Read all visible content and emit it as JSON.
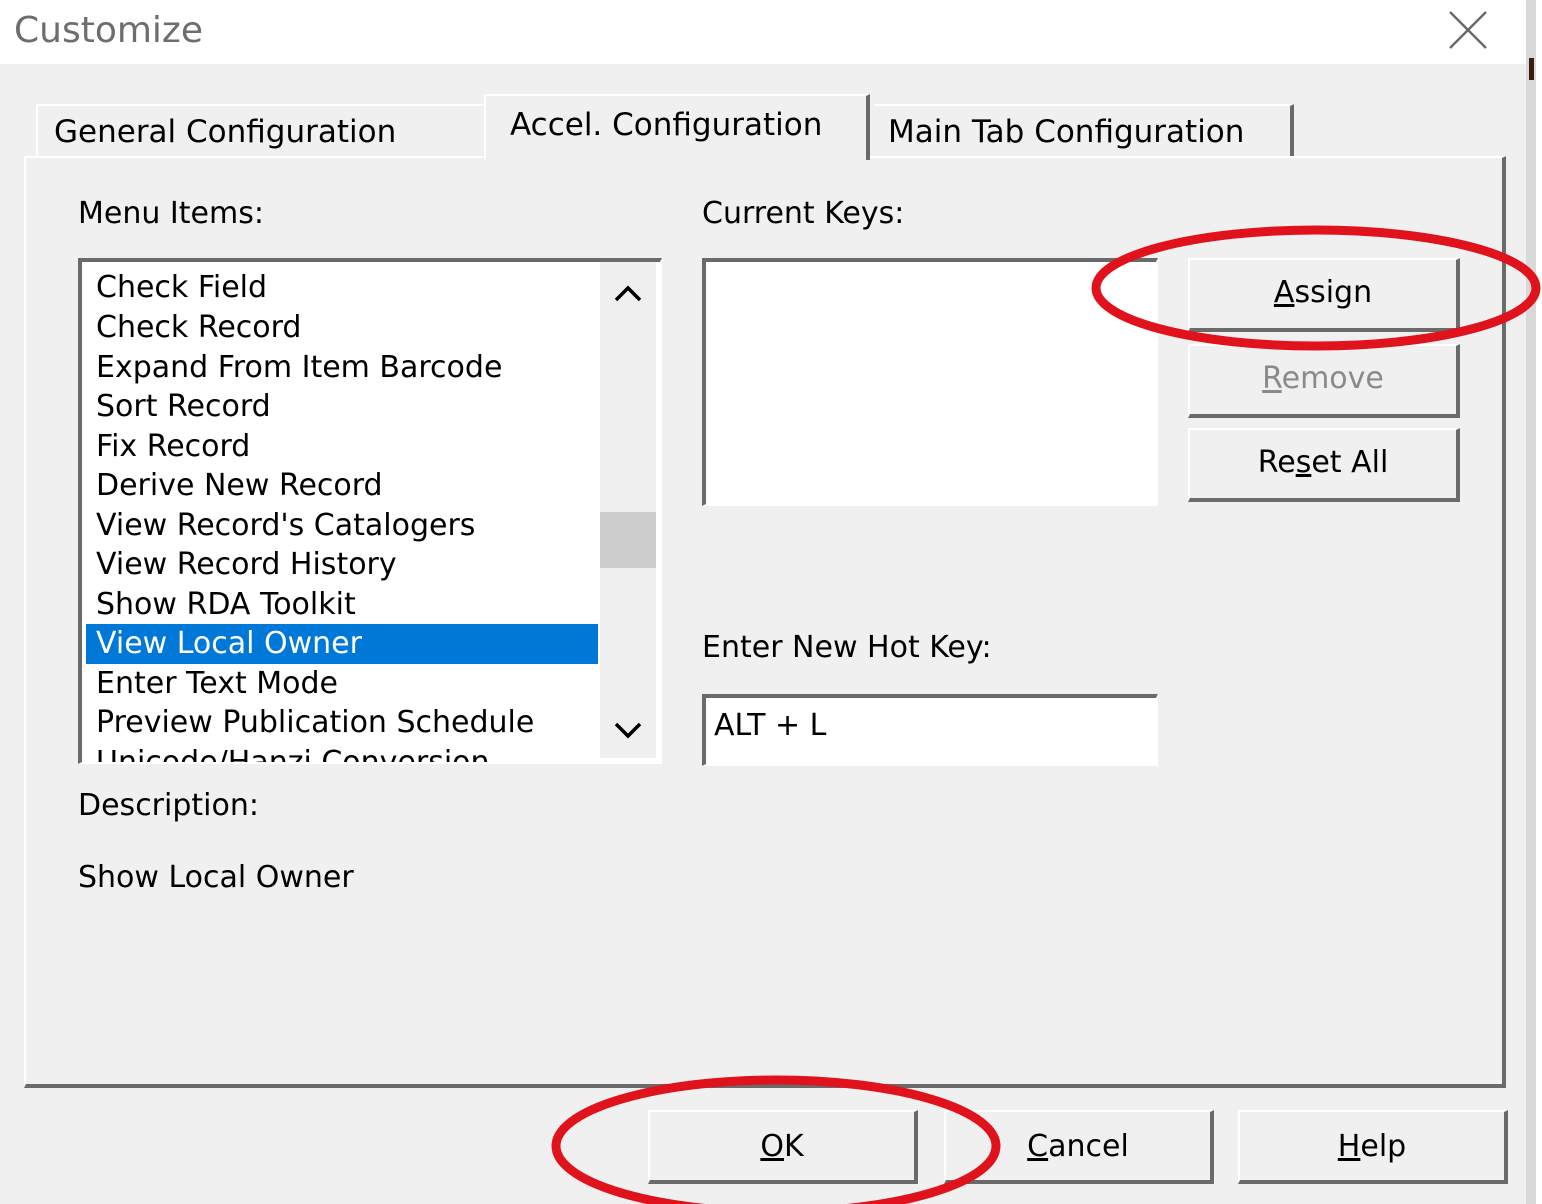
{
  "window": {
    "title": "Customize"
  },
  "tabs": [
    {
      "label": "General Configuration",
      "active": false
    },
    {
      "label": "Accel. Configuration",
      "active": true
    },
    {
      "label": "Main Tab Configuration",
      "active": false
    }
  ],
  "menu_items": {
    "label": "Menu Items:",
    "items": [
      "Check Field",
      "Check Record",
      "Expand From Item Barcode",
      "Sort Record",
      "Fix Record",
      "Derive New Record",
      "View Record's Catalogers",
      "View Record History",
      "Show RDA Toolkit",
      "View Local Owner",
      "Enter Text Mode",
      "Preview Publication Schedule",
      "Unicode/Hanzi Conversion"
    ],
    "selected": "View Local Owner"
  },
  "current_keys": {
    "label": "Current Keys:"
  },
  "hot_key": {
    "label": "Enter New Hot Key:",
    "value": "ALT + L"
  },
  "description": {
    "label": "Description:",
    "text": "Show Local Owner"
  },
  "buttons": {
    "assign": {
      "pre": "",
      "mnemonic": "A",
      "post": "ssign"
    },
    "remove": {
      "pre": "",
      "mnemonic": "R",
      "post": "emove",
      "disabled": true
    },
    "reset_all": {
      "pre": "Re",
      "mnemonic": "s",
      "post": "et All"
    },
    "ok": {
      "pre": "",
      "mnemonic": "O",
      "post": "K"
    },
    "cancel": {
      "pre": "",
      "mnemonic": "C",
      "post": "ancel"
    },
    "help": {
      "pre": "",
      "mnemonic": "H",
      "post": "elp"
    }
  },
  "colors": {
    "selection": "#0078d7",
    "annotation": "#e0121b",
    "face": "#f0f0f0"
  }
}
